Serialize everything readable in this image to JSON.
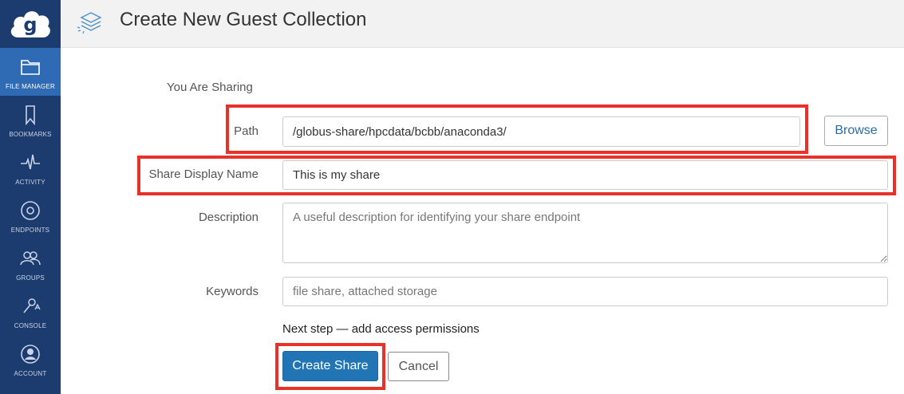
{
  "sidebar": {
    "items": [
      {
        "label": "FILE MANAGER",
        "icon": "folder-icon",
        "active": true
      },
      {
        "label": "BOOKMARKS",
        "icon": "bookmark-icon",
        "active": false
      },
      {
        "label": "ACTIVITY",
        "icon": "activity-icon",
        "active": false
      },
      {
        "label": "ENDPOINTS",
        "icon": "endpoint-icon",
        "active": false
      },
      {
        "label": "GROUPS",
        "icon": "groups-icon",
        "active": false
      },
      {
        "label": "CONSOLE",
        "icon": "console-icon",
        "active": false
      },
      {
        "label": "ACCOUNT",
        "icon": "account-icon",
        "active": false
      }
    ]
  },
  "header": {
    "title": "Create New Guest Collection",
    "icon": "layers-icon"
  },
  "form": {
    "section_label": "You Are Sharing",
    "path_label": "Path",
    "path_value": "/globus-share/hpcdata/bcbb/anaconda3/",
    "browse_label": "Browse",
    "display_name_label": "Share Display Name",
    "display_name_value": "This is my share",
    "description_label": "Description",
    "description_placeholder": "A useful description for identifying your share endpoint",
    "keywords_label": "Keywords",
    "keywords_placeholder": "file share, attached storage",
    "next_step": "Next step — add access permissions",
    "create_label": "Create Share",
    "cancel_label": "Cancel"
  },
  "colors": {
    "sidebar_bg": "#1c3b6e",
    "sidebar_active": "#2e6bb4",
    "primary_button": "#2275b4",
    "highlight": "#e8312a"
  }
}
